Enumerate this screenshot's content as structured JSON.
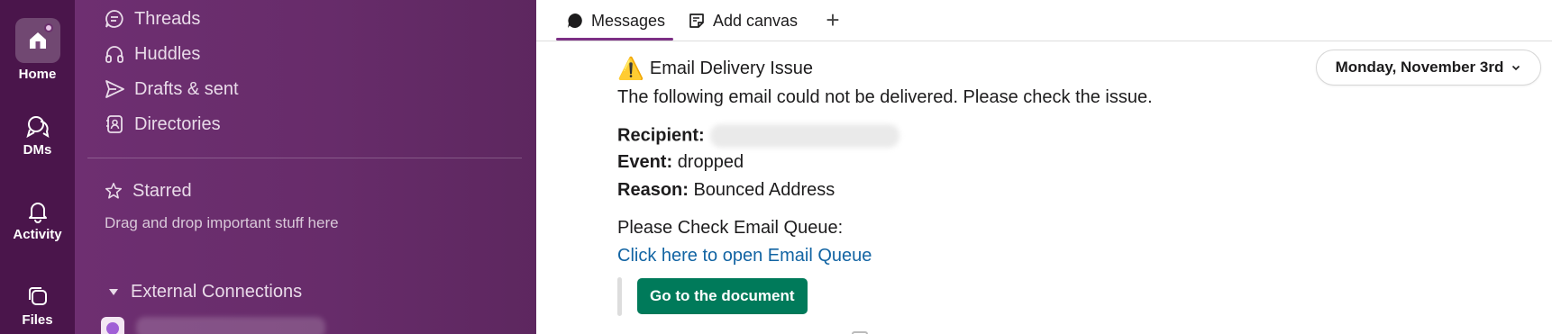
{
  "rail": {
    "items": [
      {
        "label": "Home",
        "icon": "home-icon"
      },
      {
        "label": "DMs",
        "icon": "dms-icon"
      },
      {
        "label": "Activity",
        "icon": "bell-icon"
      },
      {
        "label": "Files",
        "icon": "files-icon"
      }
    ]
  },
  "sidebar": {
    "nav": [
      {
        "label": "Threads",
        "icon": "threads-icon"
      },
      {
        "label": "Huddles",
        "icon": "headphones-icon"
      },
      {
        "label": "Drafts & sent",
        "icon": "send-icon"
      },
      {
        "label": "Directories",
        "icon": "directory-icon"
      }
    ],
    "starred": {
      "label": "Starred",
      "hint": "Drag and drop important stuff here"
    },
    "external": {
      "label": "External Connections"
    }
  },
  "tabs": {
    "messages": "Messages",
    "add_canvas": "Add canvas",
    "add": "+"
  },
  "date_divider": "Monday, November 3rd",
  "message": {
    "warning_glyph": "⚠️",
    "title": "Email Delivery Issue",
    "body": "The following email could not be delivered. Please check the issue.",
    "recipient_label": "Recipient:",
    "event_label": "Event:",
    "event_value": "dropped",
    "reason_label": "Reason:",
    "reason_value": "Bounced Address",
    "queue_prompt": "Please Check Email Queue:",
    "queue_link": "Click here to open Email Queue",
    "doc_button": "Go to the document"
  },
  "colors": {
    "rail_bg": "#4a154b",
    "sidebar_bg": "#6b2e6e",
    "tab_accent": "#7c3085",
    "link": "#1264a3",
    "button": "#007a5a"
  }
}
